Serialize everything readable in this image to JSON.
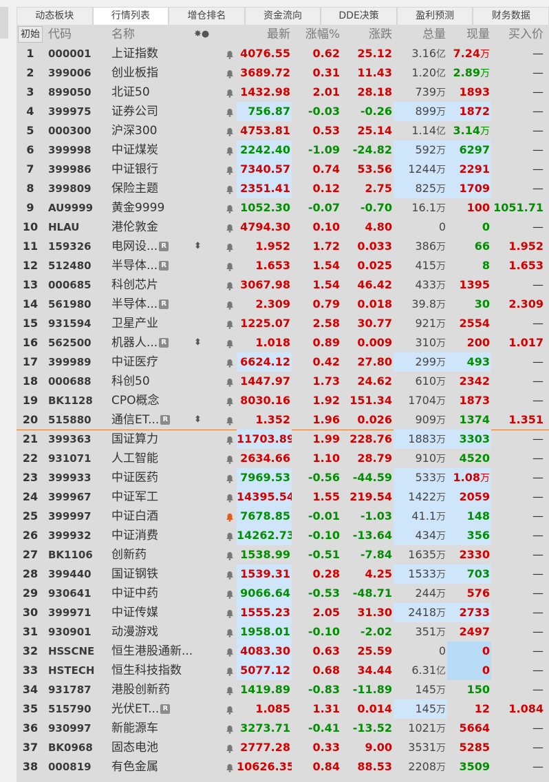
{
  "tabs": [
    "动态板块",
    "行情列表",
    "增仓排名",
    "资金流向",
    "DDE决策",
    "盈利预测",
    "财务数据"
  ],
  "active_tab": 1,
  "header": {
    "first": "初始",
    "code": "代码",
    "name": "名称",
    "bell": "✸●",
    "last": "最新",
    "pct": "涨幅%",
    "chg": "涨跌",
    "vol": "总量",
    "cur": "现量",
    "bid": "买入价"
  },
  "rows": [
    {
      "idx": "1",
      "code": "000001",
      "name": "上证指数",
      "last": "4076.55",
      "pct": "0.62",
      "chg": "25.12",
      "vol_num": "3.16",
      "vol_unit": "亿",
      "cur_num": "7.24",
      "cur_unit": "万",
      "bid": "—",
      "color": "red",
      "cur_color": "red",
      "hl_last": false,
      "hl_vol": false,
      "hl_cur": false,
      "badge": false,
      "arrows": false,
      "bell_color": "#777"
    },
    {
      "idx": "2",
      "code": "399006",
      "name": "创业板指",
      "last": "3689.72",
      "pct": "0.31",
      "chg": "11.43",
      "vol_num": "1.20",
      "vol_unit": "亿",
      "cur_num": "2.89",
      "cur_unit": "万",
      "bid": "—",
      "color": "red",
      "cur_color": "green",
      "hl_last": false,
      "hl_vol": false,
      "hl_cur": false,
      "badge": false,
      "arrows": false,
      "bell_color": "#777"
    },
    {
      "idx": "3",
      "code": "899050",
      "name": "北证50",
      "last": "1432.98",
      "pct": "2.01",
      "chg": "28.18",
      "vol_num": "739",
      "vol_unit": "万",
      "cur_num": "1893",
      "cur_unit": "",
      "bid": "—",
      "color": "red",
      "cur_color": "red",
      "hl_last": false,
      "hl_vol": false,
      "hl_cur": false,
      "badge": false,
      "arrows": false,
      "bell_color": "#777"
    },
    {
      "idx": "4",
      "code": "399975",
      "name": "证券公司",
      "last": "756.87",
      "pct": "-0.03",
      "chg": "-0.26",
      "vol_num": "899",
      "vol_unit": "万",
      "cur_num": "1872",
      "cur_unit": "",
      "bid": "—",
      "color": "green",
      "cur_color": "red",
      "hl_last": true,
      "hl_vol": true,
      "hl_cur": true,
      "badge": false,
      "arrows": false,
      "bell_color": "#777"
    },
    {
      "idx": "5",
      "code": "000300",
      "name": "沪深300",
      "last": "4753.81",
      "pct": "0.53",
      "chg": "25.14",
      "vol_num": "1.14",
      "vol_unit": "亿",
      "cur_num": "3.14",
      "cur_unit": "万",
      "bid": "—",
      "color": "red",
      "cur_color": "green",
      "hl_last": false,
      "hl_vol": false,
      "hl_cur": false,
      "badge": false,
      "arrows": false,
      "bell_color": "#777"
    },
    {
      "idx": "6",
      "code": "399998",
      "name": "中证煤炭",
      "last": "2242.40",
      "pct": "-1.09",
      "chg": "-24.82",
      "vol_num": "592",
      "vol_unit": "万",
      "cur_num": "6297",
      "cur_unit": "",
      "bid": "—",
      "color": "green",
      "cur_color": "green",
      "hl_last": true,
      "hl_vol": true,
      "hl_cur": true,
      "badge": false,
      "arrows": false,
      "bell_color": "#777"
    },
    {
      "idx": "7",
      "code": "399986",
      "name": "中证银行",
      "last": "7340.57",
      "pct": "0.74",
      "chg": "53.56",
      "vol_num": "1244",
      "vol_unit": "万",
      "cur_num": "2291",
      "cur_unit": "",
      "bid": "—",
      "color": "red",
      "cur_color": "red",
      "hl_last": true,
      "hl_vol": true,
      "hl_cur": true,
      "badge": false,
      "arrows": false,
      "bell_color": "#777"
    },
    {
      "idx": "8",
      "code": "399809",
      "name": "保险主题",
      "last": "2351.41",
      "pct": "0.12",
      "chg": "2.75",
      "vol_num": "825",
      "vol_unit": "万",
      "cur_num": "1709",
      "cur_unit": "",
      "bid": "—",
      "color": "red",
      "cur_color": "red",
      "hl_last": true,
      "hl_vol": true,
      "hl_cur": true,
      "badge": false,
      "arrows": false,
      "bell_color": "#777"
    },
    {
      "idx": "9",
      "code": "AU9999",
      "name": "黄金9999",
      "last": "1052.30",
      "pct": "-0.07",
      "chg": "-0.70",
      "vol_num": "16.1",
      "vol_unit": "万",
      "cur_num": "100",
      "cur_unit": "",
      "bid": "1051.71",
      "color": "green",
      "cur_color": "red",
      "hl_last": false,
      "hl_vol": false,
      "hl_cur": false,
      "badge": false,
      "arrows": false,
      "bell_color": "#777",
      "bid_color": "green"
    },
    {
      "idx": "10",
      "code": "HLAU",
      "name": "港伦敦金",
      "last": "4794.30",
      "pct": "0.10",
      "chg": "4.80",
      "vol_num": "0",
      "vol_unit": "",
      "cur_num": "0",
      "cur_unit": "",
      "bid": "—",
      "color": "red",
      "cur_color": "green",
      "hl_last": false,
      "hl_vol": false,
      "hl_cur": false,
      "badge": false,
      "arrows": false,
      "bell_color": "#777"
    },
    {
      "idx": "11",
      "code": "159326",
      "name": "电网设...",
      "last": "1.952",
      "pct": "1.72",
      "chg": "0.033",
      "vol_num": "386",
      "vol_unit": "万",
      "cur_num": "66",
      "cur_unit": "",
      "bid": "1.952",
      "color": "red",
      "cur_color": "green",
      "hl_last": false,
      "hl_vol": false,
      "hl_cur": false,
      "badge": true,
      "arrows": true,
      "bell_color": "#777",
      "bid_color": "red"
    },
    {
      "idx": "12",
      "code": "512480",
      "name": "半导体...",
      "last": "1.653",
      "pct": "1.54",
      "chg": "0.025",
      "vol_num": "415",
      "vol_unit": "万",
      "cur_num": "8",
      "cur_unit": "",
      "bid": "1.653",
      "color": "red",
      "cur_color": "green",
      "hl_last": false,
      "hl_vol": false,
      "hl_cur": false,
      "badge": true,
      "arrows": false,
      "bell_color": "#777",
      "bid_color": "red"
    },
    {
      "idx": "13",
      "code": "000685",
      "name": "科创芯片",
      "last": "3067.98",
      "pct": "1.54",
      "chg": "46.42",
      "vol_num": "433",
      "vol_unit": "万",
      "cur_num": "1395",
      "cur_unit": "",
      "bid": "—",
      "color": "red",
      "cur_color": "red",
      "hl_last": false,
      "hl_vol": false,
      "hl_cur": false,
      "badge": false,
      "arrows": false,
      "bell_color": "#777"
    },
    {
      "idx": "14",
      "code": "561980",
      "name": "半导体...",
      "last": "2.309",
      "pct": "0.79",
      "chg": "0.018",
      "vol_num": "39.8",
      "vol_unit": "万",
      "cur_num": "30",
      "cur_unit": "",
      "bid": "2.309",
      "color": "red",
      "cur_color": "green",
      "hl_last": false,
      "hl_vol": false,
      "hl_cur": false,
      "badge": true,
      "arrows": false,
      "bell_color": "#777",
      "bid_color": "red"
    },
    {
      "idx": "15",
      "code": "931594",
      "name": "卫星产业",
      "last": "1225.07",
      "pct": "2.58",
      "chg": "30.77",
      "vol_num": "921",
      "vol_unit": "万",
      "cur_num": "2554",
      "cur_unit": "",
      "bid": "—",
      "color": "red",
      "cur_color": "red",
      "hl_last": false,
      "hl_vol": false,
      "hl_cur": false,
      "badge": false,
      "arrows": false,
      "bell_color": "#777"
    },
    {
      "idx": "16",
      "code": "562500",
      "name": "机器人...",
      "last": "1.018",
      "pct": "0.89",
      "chg": "0.009",
      "vol_num": "310",
      "vol_unit": "万",
      "cur_num": "200",
      "cur_unit": "",
      "bid": "1.017",
      "color": "red",
      "cur_color": "red",
      "hl_last": false,
      "hl_vol": false,
      "hl_cur": false,
      "badge": true,
      "arrows": true,
      "bell_color": "#777",
      "bid_color": "red"
    },
    {
      "idx": "17",
      "code": "399989",
      "name": "中证医疗",
      "last": "6624.12",
      "pct": "0.42",
      "chg": "27.80",
      "vol_num": "299",
      "vol_unit": "万",
      "cur_num": "493",
      "cur_unit": "",
      "bid": "—",
      "color": "red",
      "cur_color": "green",
      "hl_last": true,
      "hl_vol": true,
      "hl_cur": true,
      "badge": false,
      "arrows": false,
      "bell_color": "#777"
    },
    {
      "idx": "18",
      "code": "000688",
      "name": "科创50",
      "last": "1447.97",
      "pct": "1.73",
      "chg": "24.62",
      "vol_num": "610",
      "vol_unit": "万",
      "cur_num": "2342",
      "cur_unit": "",
      "bid": "—",
      "color": "red",
      "cur_color": "red",
      "hl_last": false,
      "hl_vol": false,
      "hl_cur": false,
      "badge": false,
      "arrows": false,
      "bell_color": "#777"
    },
    {
      "idx": "19",
      "code": "BK1128",
      "name": "CPO概念",
      "last": "8030.16",
      "pct": "1.92",
      "chg": "151.34",
      "vol_num": "1704",
      "vol_unit": "万",
      "cur_num": "1873",
      "cur_unit": "",
      "bid": "—",
      "color": "red",
      "cur_color": "red",
      "hl_last": false,
      "hl_vol": false,
      "hl_cur": false,
      "badge": false,
      "arrows": false,
      "bell_color": "#777"
    },
    {
      "idx": "20",
      "code": "515880",
      "name": "通信ET...",
      "last": "1.352",
      "pct": "1.96",
      "chg": "0.026",
      "vol_num": "909",
      "vol_unit": "万",
      "cur_num": "1374",
      "cur_unit": "",
      "bid": "1.351",
      "color": "red",
      "cur_color": "green",
      "hl_last": false,
      "hl_vol": false,
      "hl_cur": false,
      "badge": true,
      "arrows": true,
      "bell_color": "#777",
      "bid_color": "red"
    },
    {
      "idx": "21",
      "code": "399363",
      "name": "国证算力",
      "last": "11703.89",
      "pct": "1.99",
      "chg": "228.76",
      "vol_num": "1883",
      "vol_unit": "万",
      "cur_num": "3303",
      "cur_unit": "",
      "bid": "—",
      "color": "red",
      "cur_color": "green",
      "hl_last": true,
      "hl_vol": true,
      "hl_cur": true,
      "badge": false,
      "arrows": false,
      "bell_color": "#777"
    },
    {
      "idx": "22",
      "code": "931071",
      "name": "人工智能",
      "last": "2634.66",
      "pct": "1.10",
      "chg": "28.79",
      "vol_num": "910",
      "vol_unit": "万",
      "cur_num": "4520",
      "cur_unit": "",
      "bid": "—",
      "color": "red",
      "cur_color": "green",
      "hl_last": false,
      "hl_vol": false,
      "hl_cur": false,
      "badge": false,
      "arrows": false,
      "bell_color": "#777"
    },
    {
      "idx": "23",
      "code": "399933",
      "name": "中证医药",
      "last": "7969.53",
      "pct": "-0.56",
      "chg": "-44.59",
      "vol_num": "533",
      "vol_unit": "万",
      "cur_num": "1.08",
      "cur_unit": "万",
      "bid": "—",
      "color": "green",
      "cur_color": "red",
      "hl_last": true,
      "hl_vol": true,
      "hl_cur": true,
      "badge": false,
      "arrows": false,
      "bell_color": "#777"
    },
    {
      "idx": "24",
      "code": "399967",
      "name": "中证军工",
      "last": "14395.54",
      "pct": "1.55",
      "chg": "219.54",
      "vol_num": "1422",
      "vol_unit": "万",
      "cur_num": "2059",
      "cur_unit": "",
      "bid": "—",
      "color": "red",
      "cur_color": "red",
      "hl_last": true,
      "hl_vol": true,
      "hl_cur": true,
      "badge": false,
      "arrows": false,
      "bell_color": "#777"
    },
    {
      "idx": "25",
      "code": "399997",
      "name": "中证白酒",
      "last": "7678.85",
      "pct": "-0.01",
      "chg": "-1.03",
      "vol_num": "41.1",
      "vol_unit": "万",
      "cur_num": "148",
      "cur_unit": "",
      "bid": "—",
      "color": "green",
      "cur_color": "green",
      "hl_last": true,
      "hl_vol": true,
      "hl_cur": true,
      "badge": false,
      "arrows": false,
      "bell_color": "#e05a1a"
    },
    {
      "idx": "26",
      "code": "399932",
      "name": "中证消费",
      "last": "14262.73",
      "pct": "-0.10",
      "chg": "-13.64",
      "vol_num": "434",
      "vol_unit": "万",
      "cur_num": "356",
      "cur_unit": "",
      "bid": "—",
      "color": "green",
      "cur_color": "green",
      "hl_last": true,
      "hl_vol": true,
      "hl_cur": true,
      "badge": false,
      "arrows": false,
      "bell_color": "#777"
    },
    {
      "idx": "27",
      "code": "BK1106",
      "name": "创新药",
      "last": "1538.99",
      "pct": "-0.51",
      "chg": "-7.84",
      "vol_num": "1635",
      "vol_unit": "万",
      "cur_num": "2330",
      "cur_unit": "",
      "bid": "—",
      "color": "green",
      "cur_color": "red",
      "hl_last": false,
      "hl_vol": false,
      "hl_cur": false,
      "badge": false,
      "arrows": false,
      "bell_color": "#777"
    },
    {
      "idx": "28",
      "code": "399440",
      "name": "国证钢铁",
      "last": "1539.31",
      "pct": "0.28",
      "chg": "4.25",
      "vol_num": "1533",
      "vol_unit": "万",
      "cur_num": "703",
      "cur_unit": "",
      "bid": "—",
      "color": "red",
      "cur_color": "green",
      "hl_last": true,
      "hl_vol": true,
      "hl_cur": true,
      "badge": false,
      "arrows": false,
      "bell_color": "#777"
    },
    {
      "idx": "29",
      "code": "930641",
      "name": "中证中药",
      "last": "9066.64",
      "pct": "-0.53",
      "chg": "-48.71",
      "vol_num": "244",
      "vol_unit": "万",
      "cur_num": "576",
      "cur_unit": "",
      "bid": "—",
      "color": "green",
      "cur_color": "red",
      "hl_last": true,
      "hl_vol": false,
      "hl_cur": false,
      "badge": false,
      "arrows": false,
      "bell_color": "#777"
    },
    {
      "idx": "30",
      "code": "399971",
      "name": "中证传媒",
      "last": "1555.23",
      "pct": "2.05",
      "chg": "31.30",
      "vol_num": "2418",
      "vol_unit": "万",
      "cur_num": "2733",
      "cur_unit": "",
      "bid": "—",
      "color": "red",
      "cur_color": "red",
      "hl_last": true,
      "hl_vol": true,
      "hl_cur": true,
      "badge": false,
      "arrows": false,
      "bell_color": "#777"
    },
    {
      "idx": "31",
      "code": "930901",
      "name": "动漫游戏",
      "last": "1958.01",
      "pct": "-0.10",
      "chg": "-2.02",
      "vol_num": "351",
      "vol_unit": "万",
      "cur_num": "2497",
      "cur_unit": "",
      "bid": "—",
      "color": "green",
      "cur_color": "red",
      "hl_last": true,
      "hl_vol": false,
      "hl_cur": false,
      "badge": false,
      "arrows": false,
      "bell_color": "#777"
    },
    {
      "idx": "32",
      "code": "HSSCNE",
      "name": "恒生港股通新...",
      "last": "4083.30",
      "pct": "0.63",
      "chg": "25.59",
      "vol_num": "0",
      "vol_unit": "",
      "cur_num": "0",
      "cur_unit": "",
      "bid": "—",
      "color": "red",
      "cur_color": "red",
      "hl_last": true,
      "hl_vol": false,
      "hl_cur": true,
      "badge": false,
      "arrows": false,
      "bell_color": "#777"
    },
    {
      "idx": "33",
      "code": "HSTECH",
      "name": "恒生科技指数",
      "last": "5077.12",
      "pct": "0.68",
      "chg": "34.44",
      "vol_num": "6.31",
      "vol_unit": "亿",
      "cur_num": "0",
      "cur_unit": "",
      "bid": "—",
      "color": "red",
      "cur_color": "red",
      "hl_last": true,
      "hl_vol": false,
      "hl_cur": true,
      "badge": false,
      "arrows": false,
      "bell_color": "#777"
    },
    {
      "idx": "34",
      "code": "931787",
      "name": "港股创新药",
      "last": "1419.89",
      "pct": "-0.83",
      "chg": "-11.89",
      "vol_num": "145",
      "vol_unit": "万",
      "cur_num": "150",
      "cur_unit": "",
      "bid": "—",
      "color": "green",
      "cur_color": "green",
      "hl_last": false,
      "hl_vol": false,
      "hl_cur": false,
      "badge": false,
      "arrows": false,
      "bell_color": "#777"
    },
    {
      "idx": "35",
      "code": "515790",
      "name": "光伏ET...",
      "last": "1.085",
      "pct": "1.31",
      "chg": "0.014",
      "vol_num": "145",
      "vol_unit": "万",
      "cur_num": "12",
      "cur_unit": "",
      "bid": "1.084",
      "color": "red",
      "cur_color": "red",
      "hl_last": false,
      "hl_vol": true,
      "hl_cur": false,
      "badge": true,
      "arrows": false,
      "bell_color": "#777",
      "bid_color": "red"
    },
    {
      "idx": "36",
      "code": "930997",
      "name": "新能源车",
      "last": "3273.71",
      "pct": "-0.41",
      "chg": "-13.52",
      "vol_num": "1021",
      "vol_unit": "万",
      "cur_num": "5664",
      "cur_unit": "",
      "bid": "—",
      "color": "green",
      "cur_color": "red",
      "hl_last": false,
      "hl_vol": false,
      "hl_cur": false,
      "badge": false,
      "arrows": false,
      "bell_color": "#777"
    },
    {
      "idx": "37",
      "code": "BK0968",
      "name": "固态电池",
      "last": "2777.28",
      "pct": "0.33",
      "chg": "9.00",
      "vol_num": "3531",
      "vol_unit": "万",
      "cur_num": "5285",
      "cur_unit": "",
      "bid": "—",
      "color": "red",
      "cur_color": "red",
      "hl_last": false,
      "hl_vol": false,
      "hl_cur": false,
      "badge": false,
      "arrows": false,
      "bell_color": "#777"
    },
    {
      "idx": "38",
      "code": "000819",
      "name": "有色金属",
      "last": "10626.35",
      "pct": "0.84",
      "chg": "88.53",
      "vol_num": "2208",
      "vol_unit": "万",
      "cur_num": "3509",
      "cur_unit": "",
      "bid": "—",
      "color": "red",
      "cur_color": "green",
      "hl_last": false,
      "hl_vol": false,
      "hl_cur": false,
      "badge": false,
      "arrows": false,
      "bell_color": "#777"
    }
  ],
  "badge_letter": "R",
  "arrows_glyph": "⬍"
}
